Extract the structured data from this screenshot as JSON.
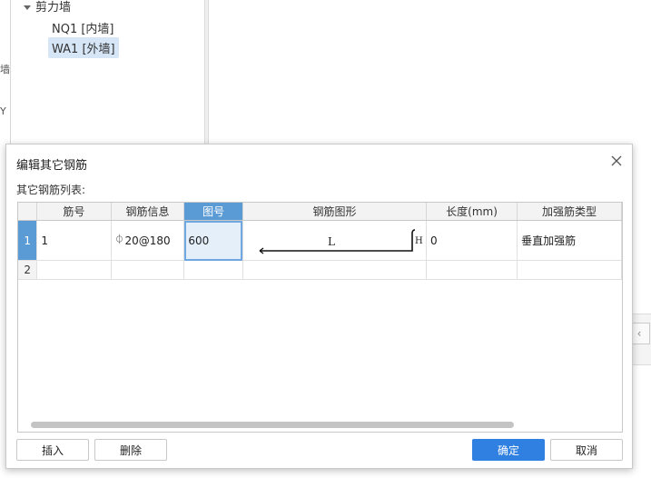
{
  "tree": {
    "group_label": "剪力墙",
    "items": [
      {
        "label": "NQ1 [内墙]",
        "selected": false
      },
      {
        "label": "WA1 [外墙]",
        "selected": true
      }
    ],
    "left_strip_chars": [
      "墙",
      "Y"
    ]
  },
  "dialog": {
    "title": "编辑其它钢筋",
    "list_label": "其它钢筋列表:",
    "columns": [
      "筋号",
      "钢筋信息",
      "图号",
      "钢筋图形",
      "长度(mm)",
      "加强筋类型"
    ],
    "active_column": "图号",
    "rows": [
      {
        "num": "1",
        "bar_no": "1",
        "grade_symbol": "⏀",
        "bar_info": "20@180",
        "figure_no": "600",
        "shape_L": "L",
        "shape_H": "H",
        "length": "0",
        "type": "垂直加强筋"
      },
      {
        "num": "2",
        "bar_no": "",
        "grade_symbol": "",
        "bar_info": "",
        "figure_no": "",
        "shape_L": "",
        "shape_H": "",
        "length": "",
        "type": ""
      }
    ],
    "buttons": {
      "insert": "插入",
      "delete": "删除",
      "ok": "确定",
      "cancel": "取消"
    },
    "colors": {
      "accent": "#2f80e0",
      "header_active": "#5b9bd5"
    }
  }
}
